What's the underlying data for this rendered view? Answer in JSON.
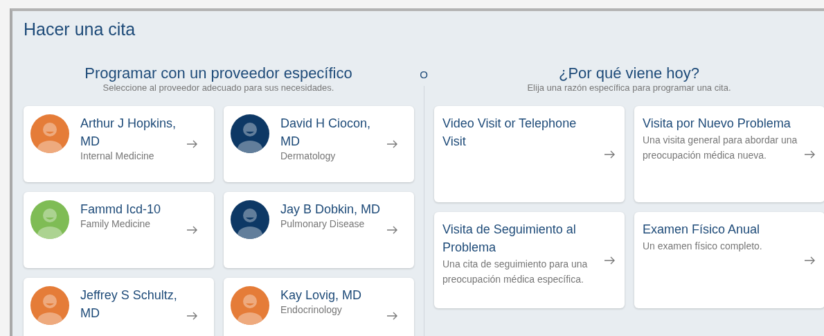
{
  "title": "Hacer una cita",
  "providers_section": {
    "heading": "Programar con un proveedor específico",
    "subheading": "Seleccione al proveedor adecuado para sus necesidades.",
    "providers": [
      {
        "name": "Arthur J Hopkins, MD",
        "specialty": "Internal Medicine",
        "color": "#e57c38"
      },
      {
        "name": "David H Ciocon, MD",
        "specialty": "Dermatology",
        "color": "#0d3865"
      },
      {
        "name": "Fammd Icd-10",
        "specialty": "Family Medicine",
        "color": "#7fbc55"
      },
      {
        "name": "Jay B Dobkin, MD",
        "specialty": "Pulmonary Disease",
        "color": "#0d3865"
      },
      {
        "name": "Jeffrey S Schultz, MD",
        "color": "#e57c38"
      },
      {
        "name": "Kay Lovig, MD",
        "specialty": "Endocrinology",
        "color": "#e57c38"
      }
    ]
  },
  "separator": "O",
  "reasons_section": {
    "heading": "¿Por qué viene hoy?",
    "subheading": "Elija una razón específica para programar una cita.",
    "reasons": [
      {
        "title": "Video Visit or Telephone Visit"
      },
      {
        "title": "Visita por Nuevo Problema",
        "description": "Una visita general para abordar una preocupación médica nueva."
      },
      {
        "title": "Visita de Seguimiento al Problema",
        "description": "Una cita de seguimiento para una preocupación médica específica."
      },
      {
        "title": "Examen Físico Anual",
        "description": "Un examen físico completo."
      }
    ]
  }
}
